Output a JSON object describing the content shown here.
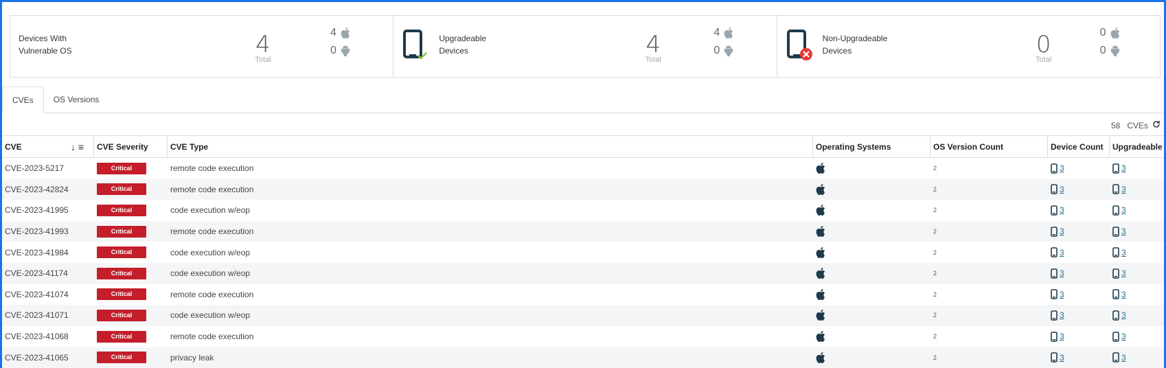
{
  "cards": [
    {
      "title_line1": "Devices With",
      "title_line2": "Vulnerable OS",
      "total": "4",
      "total_label": "Total",
      "apple_count": "4",
      "android_count": "0"
    },
    {
      "title_line1": "Upgradeable",
      "title_line2": "Devices",
      "total": "4",
      "total_label": "Total",
      "apple_count": "4",
      "android_count": "0",
      "icon": "device-check-icon"
    },
    {
      "title_line1": "Non-Upgradeable",
      "title_line2": "Devices",
      "total": "0",
      "total_label": "Total",
      "apple_count": "0",
      "android_count": "0",
      "icon": "device-error-icon"
    }
  ],
  "tabs": [
    {
      "label": "CVEs"
    },
    {
      "label": "OS Versions"
    }
  ],
  "summary": {
    "count": "58",
    "unit": "CVEs"
  },
  "columns": [
    "CVE",
    "CVE Severity",
    "CVE Type",
    "Operating Systems",
    "OS Version Count",
    "Device Count",
    "Upgradeable"
  ],
  "rows": [
    {
      "cve": "CVE-2023-5217",
      "severity": "Critical",
      "type": "remote code execution",
      "os_version_count": "2",
      "device_count": "3",
      "upgradeable": "3"
    },
    {
      "cve": "CVE-2023-42824",
      "severity": "Critical",
      "type": "remote code execution",
      "os_version_count": "2",
      "device_count": "3",
      "upgradeable": "3"
    },
    {
      "cve": "CVE-2023-41995",
      "severity": "Critical",
      "type": "code execution w/eop",
      "os_version_count": "2",
      "device_count": "3",
      "upgradeable": "3"
    },
    {
      "cve": "CVE-2023-41993",
      "severity": "Critical",
      "type": "remote code execution",
      "os_version_count": "2",
      "device_count": "3",
      "upgradeable": "3"
    },
    {
      "cve": "CVE-2023-41984",
      "severity": "Critical",
      "type": "code execution w/eop",
      "os_version_count": "2",
      "device_count": "3",
      "upgradeable": "3"
    },
    {
      "cve": "CVE-2023-41174",
      "severity": "Critical",
      "type": "code execution w/eop",
      "os_version_count": "2",
      "device_count": "3",
      "upgradeable": "3"
    },
    {
      "cve": "CVE-2023-41074",
      "severity": "Critical",
      "type": "remote code execution",
      "os_version_count": "2",
      "device_count": "3",
      "upgradeable": "3"
    },
    {
      "cve": "CVE-2023-41071",
      "severity": "Critical",
      "type": "code execution w/eop",
      "os_version_count": "2",
      "device_count": "3",
      "upgradeable": "3"
    },
    {
      "cve": "CVE-2023-41068",
      "severity": "Critical",
      "type": "remote code execution",
      "os_version_count": "2",
      "device_count": "3",
      "upgradeable": "3"
    },
    {
      "cve": "CVE-2023-41065",
      "severity": "Critical",
      "type": "privacy leak",
      "os_version_count": "2",
      "device_count": "3",
      "upgradeable": "3"
    }
  ],
  "colors": {
    "critical": "#c41e2a",
    "frame": "#1a73e8",
    "device_icon": "#1f3a4a",
    "check": "#8bc34a",
    "error": "#e53935"
  }
}
